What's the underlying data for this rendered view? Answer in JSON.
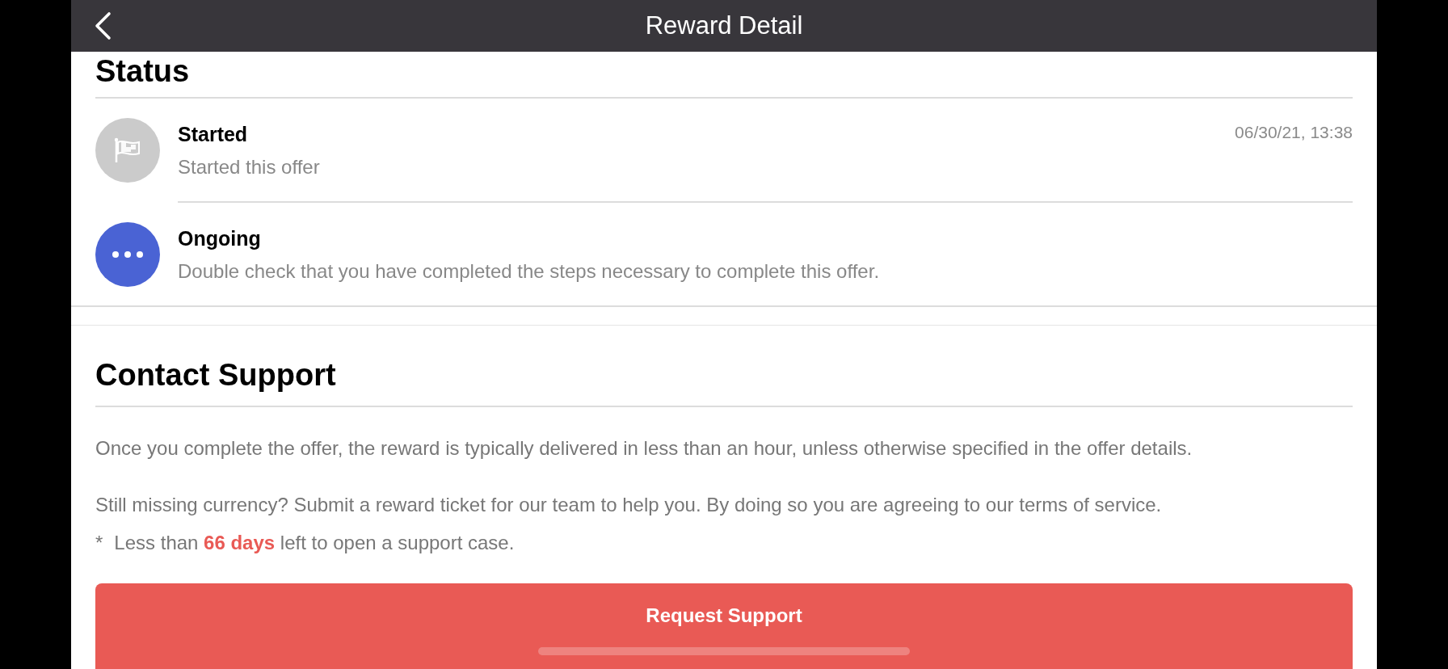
{
  "header": {
    "title": "Reward Detail"
  },
  "status": {
    "title": "Status",
    "steps": [
      {
        "kind": "started",
        "color": "#cbcbcb",
        "title": "Started",
        "description": "Started this offer",
        "time": "06/30/21, 13:38"
      },
      {
        "kind": "ongoing",
        "color": "#4a63d4",
        "title": "Ongoing",
        "description": "Double check that you have completed the steps necessary to complete this offer."
      }
    ]
  },
  "contact": {
    "title": "Contact Support",
    "paragraphs": [
      "Once you complete the offer, the reward is typically delivered in less than an hour, unless otherwise specified in the offer details.",
      "Still missing currency? Submit a reward ticket for our team to help you. By doing so you are agreeing to our terms of service."
    ],
    "note": {
      "marker": "*",
      "text": "Less than **66 days** left to open a support case."
    },
    "button": "Request Support"
  }
}
